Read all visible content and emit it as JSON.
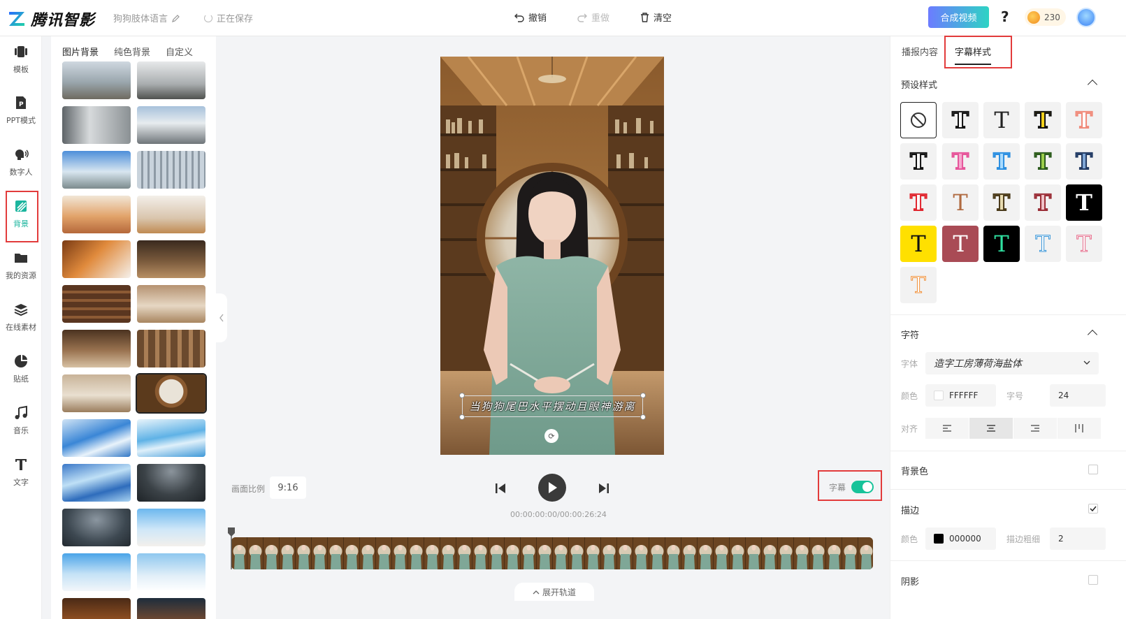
{
  "header": {
    "brand": "腾讯智影",
    "project_name": "狗狗肢体语言",
    "save_status": "正在保存",
    "undo": "撤销",
    "redo": "重做",
    "clear": "清空",
    "compose": "合成视频",
    "help": "?",
    "coins": "230"
  },
  "sidebar": {
    "items": [
      {
        "label": "模板"
      },
      {
        "label": "PPT模式"
      },
      {
        "label": "数字人"
      },
      {
        "label": "背景"
      },
      {
        "label": "我的资源"
      },
      {
        "label": "在线素材"
      },
      {
        "label": "贴纸"
      },
      {
        "label": "音乐"
      },
      {
        "label": "文字"
      }
    ]
  },
  "bg_panel": {
    "tabs": [
      "图片背景",
      "纯色背景",
      "自定义"
    ]
  },
  "canvas": {
    "caption": "当狗狗尾巴水平摆动且眼神游离"
  },
  "controls": {
    "ratio_label": "画面比例",
    "ratio_value": "9:16",
    "timecode": "00:00:00:00/00:00:26:24",
    "subtitle_label": "字幕",
    "subtitle_on": true,
    "expand_track": "展开轨道"
  },
  "right_panel": {
    "tabs": [
      "播报内容",
      "字幕样式"
    ],
    "preset_title": "预设样式",
    "char_title": "字符",
    "font_label": "字体",
    "font_value": "造字工房薄荷海盐体",
    "color_label": "颜色",
    "color_value": "FFFFFF",
    "size_label": "字号",
    "size_value": "24",
    "align_label": "对齐",
    "bg_color_title": "背景色",
    "stroke_title": "描边",
    "stroke_color_label": "颜色",
    "stroke_color_value": "000000",
    "stroke_width_label": "描边粗细",
    "stroke_width_value": "2",
    "shadow_title": "阴影"
  },
  "colors": {
    "accent": "#1bb59e",
    "highlight_box": "#e23b3b"
  }
}
